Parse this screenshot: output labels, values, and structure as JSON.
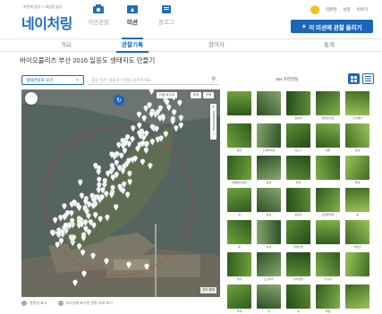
{
  "header": {
    "breadcrumb": "자연에 묻다 × 세상을 읽다",
    "logo": "네이처링",
    "nav": [
      {
        "label": "자연관찰",
        "icon": "camera-icon"
      },
      {
        "label": "미션",
        "icon": "flag-icon"
      },
      {
        "label": "블로그",
        "icon": "book-icon"
      }
    ],
    "links": [
      "김환경",
      "설정",
      "이야기"
    ],
    "upload_button": "이 미션에 관찰 올리기"
  },
  "tabs": [
    "개요",
    "관찰기록",
    "참여자",
    "통계"
  ],
  "active_tab": "관찰기록",
  "page_title": "바이오블리츠 부산 2016 일응도 생태지도 만들기",
  "filter": {
    "select_value": "생태관찰로 보기",
    "search_placeholder": "찾고 싶은 생물의 이름을 입력하세요",
    "gallery_label": "364 자연관찰"
  },
  "map": {
    "controls": [
      "다음 로드뷰",
      "위성",
      "지형"
    ],
    "zoom_label": "지도 확대",
    "refresh_icon": "refresh-icon"
  },
  "legend": [
    "관찰지 표시",
    "지도상에 표시된 관찰 자료 보기"
  ],
  "colors": {
    "accent": "#1a66b8",
    "pin": "#ffffff",
    "circle": "#c0392b"
  },
  "gallery": {
    "items": [
      {
        "label": ""
      },
      {
        "label": ""
      },
      {
        "label": "참새피"
      },
      {
        "label": "방울토마토"
      },
      {
        "label": "소리쟁이"
      },
      {
        "label": "갈대"
      },
      {
        "label": "도깨비바늘"
      },
      {
        "label": "쇠뜨기"
      },
      {
        "label": "깨풀"
      },
      {
        "label": "갈대"
      },
      {
        "label": "털별꽃아재비"
      },
      {
        "label": "갈대"
      },
      {
        "label": "솔새"
      },
      {
        "label": ""
      },
      {
        "label": "돌콩"
      },
      {
        "label": "띠"
      },
      {
        "label": "갈대"
      },
      {
        "label": "참새피"
      },
      {
        "label": "큰달뿌리풀"
      },
      {
        "label": "쑥"
      },
      {
        "label": "쑥"
      },
      {
        "label": "솔새"
      },
      {
        "label": "달맞이꽃"
      },
      {
        "label": ""
      },
      {
        "label": "개망초"
      },
      {
        "label": "갈대"
      },
      {
        "label": "도꼬마리"
      },
      {
        "label": "닭의장풀"
      },
      {
        "label": "엉겅퀴"
      },
      {
        "label": ""
      },
      {
        "label": "억새"
      },
      {
        "label": "띠"
      },
      {
        "label": "쑥"
      },
      {
        "label": "돌콩"
      },
      {
        "label": ""
      }
    ]
  }
}
